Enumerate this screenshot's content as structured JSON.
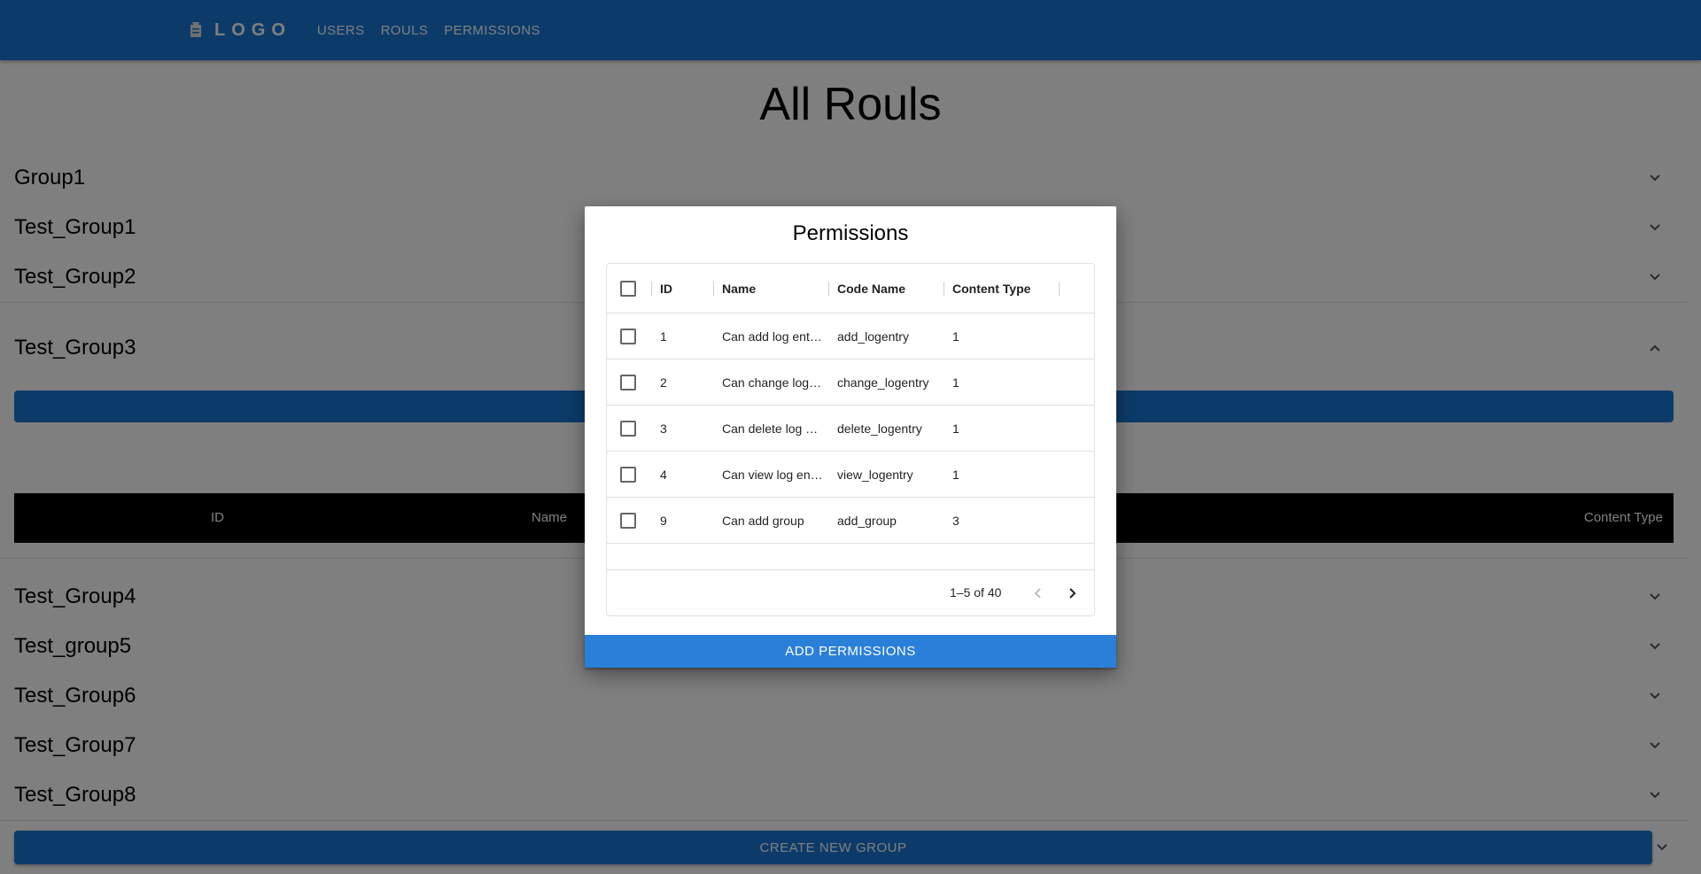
{
  "navbar": {
    "logo": "LOGO",
    "items": [
      "USERS",
      "ROULS",
      "PERMISSIONS"
    ]
  },
  "page": {
    "title": "All Rouls"
  },
  "groups": [
    "Group1",
    "Test_Group1",
    "Test_Group2",
    "Test_Group3",
    "Test_Group4",
    "Test_group5",
    "Test_Group6",
    "Test_Group7",
    "Test_Group8"
  ],
  "expanded_group": {
    "table_headers": {
      "id": "ID",
      "name": "Name",
      "content_type": "Content Type"
    }
  },
  "create_button": "CREATE NEW GROUP",
  "modal": {
    "title": "Permissions",
    "columns": [
      "ID",
      "Name",
      "Code Name",
      "Content Type"
    ],
    "rows": [
      {
        "id": "1",
        "name": "Can add log ent…",
        "code_name": "add_logentry",
        "content_type": "1"
      },
      {
        "id": "2",
        "name": "Can change log…",
        "code_name": "change_logentry",
        "content_type": "1"
      },
      {
        "id": "3",
        "name": "Can delete log …",
        "code_name": "delete_logentry",
        "content_type": "1"
      },
      {
        "id": "4",
        "name": "Can view log en…",
        "code_name": "view_logentry",
        "content_type": "1"
      },
      {
        "id": "9",
        "name": "Can add group",
        "code_name": "add_group",
        "content_type": "3"
      }
    ],
    "pagination": "1–5 of 40",
    "add_button": "ADD PERMISSIONS"
  }
}
